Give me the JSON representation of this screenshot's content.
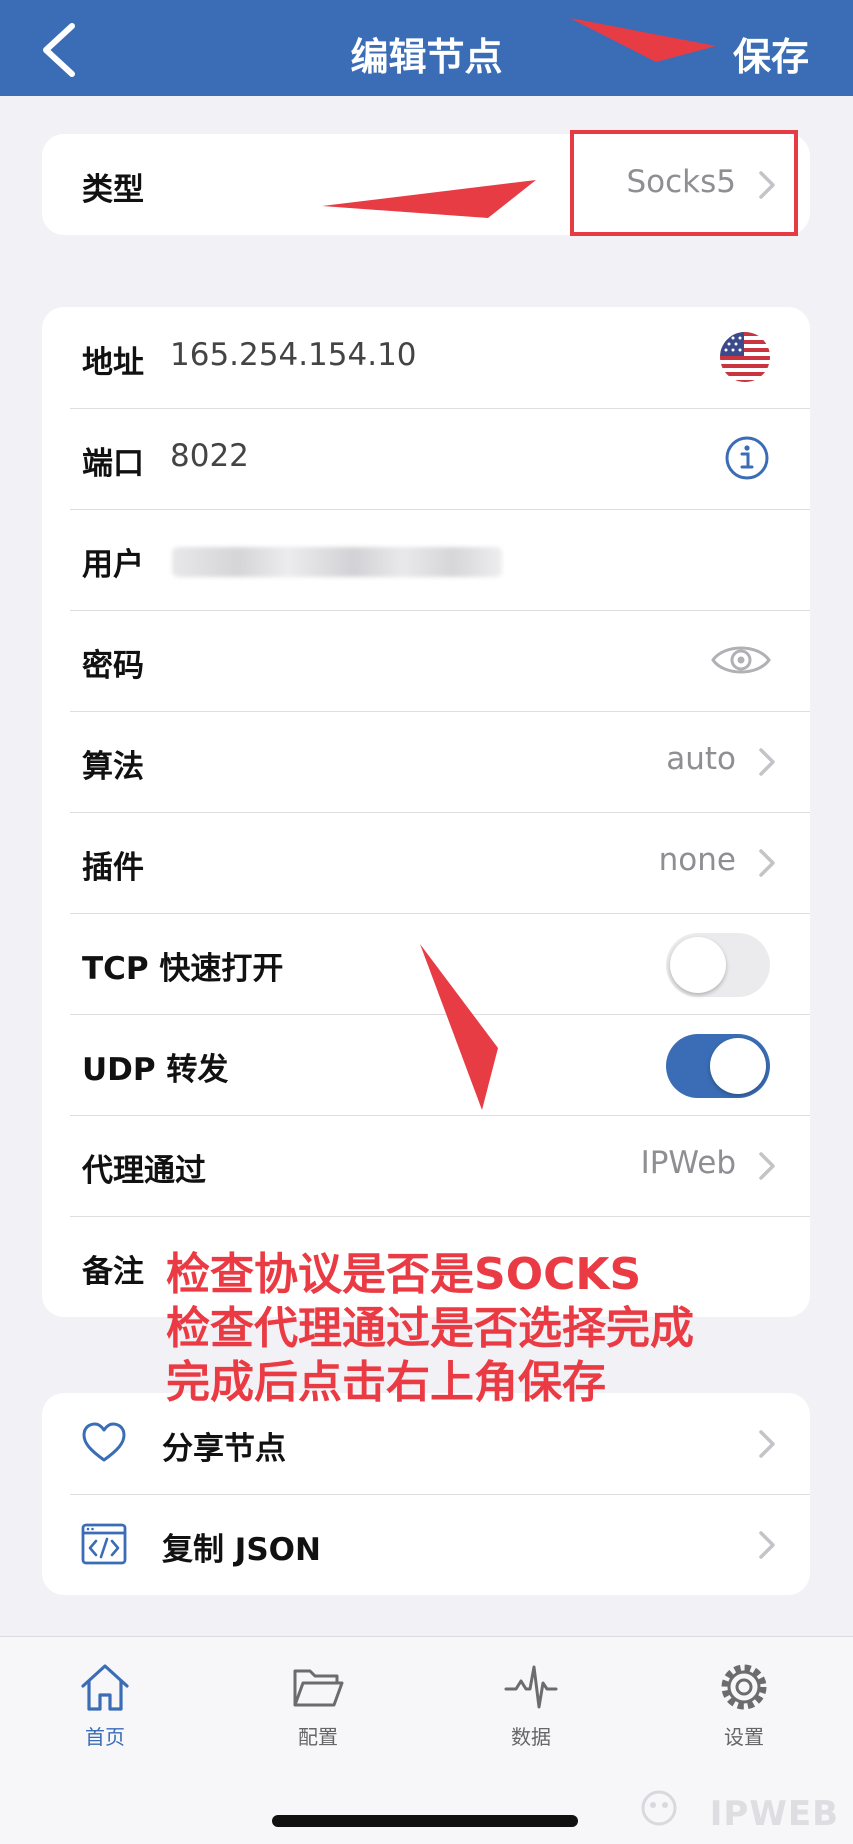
{
  "navbar": {
    "back_icon": "chevron-left-icon",
    "title": "编辑节点",
    "save_label": "保存"
  },
  "type_row": {
    "label": "类型",
    "value": "Socks5"
  },
  "fields": {
    "address": {
      "label": "地址",
      "value": "165.254.154.10",
      "icon": "us-flag-icon"
    },
    "port": {
      "label": "端口",
      "value": "8022",
      "icon": "info-icon"
    },
    "user": {
      "label": "用户"
    },
    "password": {
      "label": "密码",
      "icon": "eye-icon"
    },
    "cipher": {
      "label": "算法",
      "value": "auto"
    },
    "plugin": {
      "label": "插件",
      "value": "none"
    },
    "tcp_fast_open": {
      "label": "TCP 快速打开",
      "enabled": false
    },
    "udp_relay": {
      "label": "UDP 转发",
      "enabled": true
    },
    "proxy_via": {
      "label": "代理通过",
      "value": "IPWeb"
    },
    "remark": {
      "label": "备注"
    }
  },
  "actions": {
    "share": {
      "label": "分享节点",
      "icon": "heart-icon"
    },
    "copy_json": {
      "label": "复制 JSON",
      "icon": "code-icon"
    }
  },
  "annotation": {
    "line1": "检查协议是否是SOCKS",
    "line2": "检查代理通过是否选择完成",
    "line3": "完成后点击右上角保存"
  },
  "tabbar": {
    "tabs": [
      {
        "label": "首页",
        "icon": "home-icon",
        "active": true
      },
      {
        "label": "配置",
        "icon": "folder-icon",
        "active": false
      },
      {
        "label": "数据",
        "icon": "pulse-icon",
        "active": false
      },
      {
        "label": "设置",
        "icon": "gear-icon",
        "active": false
      }
    ]
  },
  "watermark": "IPWEB",
  "colors": {
    "accent": "#3a6db5",
    "annotation": "#ea3b44",
    "background": "#f2f2f6"
  }
}
